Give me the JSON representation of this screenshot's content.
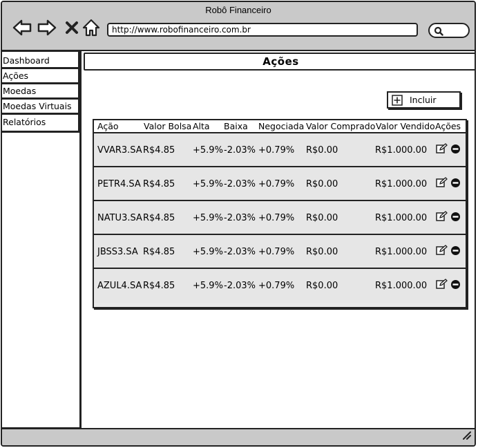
{
  "window": {
    "title": "Robô Financeiro"
  },
  "browser": {
    "url": "http://www.robofinanceiro.com.br",
    "icons": {
      "back": "back-arrow-icon",
      "forward": "forward-arrow-icon",
      "stop": "close-icon",
      "home": "home-icon",
      "search": "search-icon"
    }
  },
  "sidebar": {
    "items": [
      {
        "label": "Dashboard"
      },
      {
        "label": "Ações"
      },
      {
        "label": "Moedas"
      },
      {
        "label": "Moedas Virtuais"
      },
      {
        "label": "Relatórios"
      }
    ]
  },
  "page": {
    "title": "Ações",
    "include_button": "Incluir"
  },
  "table": {
    "headers": {
      "acao": "Ação",
      "valor_bolsa": "Valor Bolsa",
      "alta": "Alta",
      "baixa": "Baixa",
      "negociada": "Negociada",
      "valor_comprado": "Valor Comprado",
      "valor_vendido": "Valor Vendido",
      "acoes": "Ações"
    },
    "rows": [
      {
        "acao": "VVAR3.SA",
        "valor_bolsa": "R$4.85",
        "alta": "+5.9%",
        "baixa": "-2.03%",
        "negociada": "+0.79%",
        "valor_comprado": "R$0.00",
        "valor_vendido": "R$1.000.00"
      },
      {
        "acao": "PETR4.SA",
        "valor_bolsa": "R$4.85",
        "alta": "+5.9%",
        "baixa": "-2.03%",
        "negociada": "+0.79%",
        "valor_comprado": "R$0.00",
        "valor_vendido": "R$1.000.00"
      },
      {
        "acao": "NATU3.SA",
        "valor_bolsa": "R$4.85",
        "alta": "+5.9%",
        "baixa": "-2.03%",
        "negociada": "+0.79%",
        "valor_comprado": "R$0.00",
        "valor_vendido": "R$1.000.00"
      },
      {
        "acao": "JBSS3.SA",
        "valor_bolsa": "R$4.85",
        "alta": "+5.9%",
        "baixa": "-2.03%",
        "negociada": "+0.79%",
        "valor_comprado": "R$0.00",
        "valor_vendido": "R$1.000.00"
      },
      {
        "acao": "AZUL4.SA",
        "valor_bolsa": "R$4.85",
        "alta": "+5.9%",
        "baixa": "-2.03%",
        "negociada": "+0.79%",
        "valor_comprado": "R$0.00",
        "valor_vendido": "R$1.000.00"
      }
    ],
    "row_icons": {
      "edit": "edit-icon",
      "remove": "remove-icon"
    }
  },
  "colors": {
    "chrome": "#c9c9c9",
    "row_bg": "#e6e6e6",
    "border": "#222222"
  }
}
